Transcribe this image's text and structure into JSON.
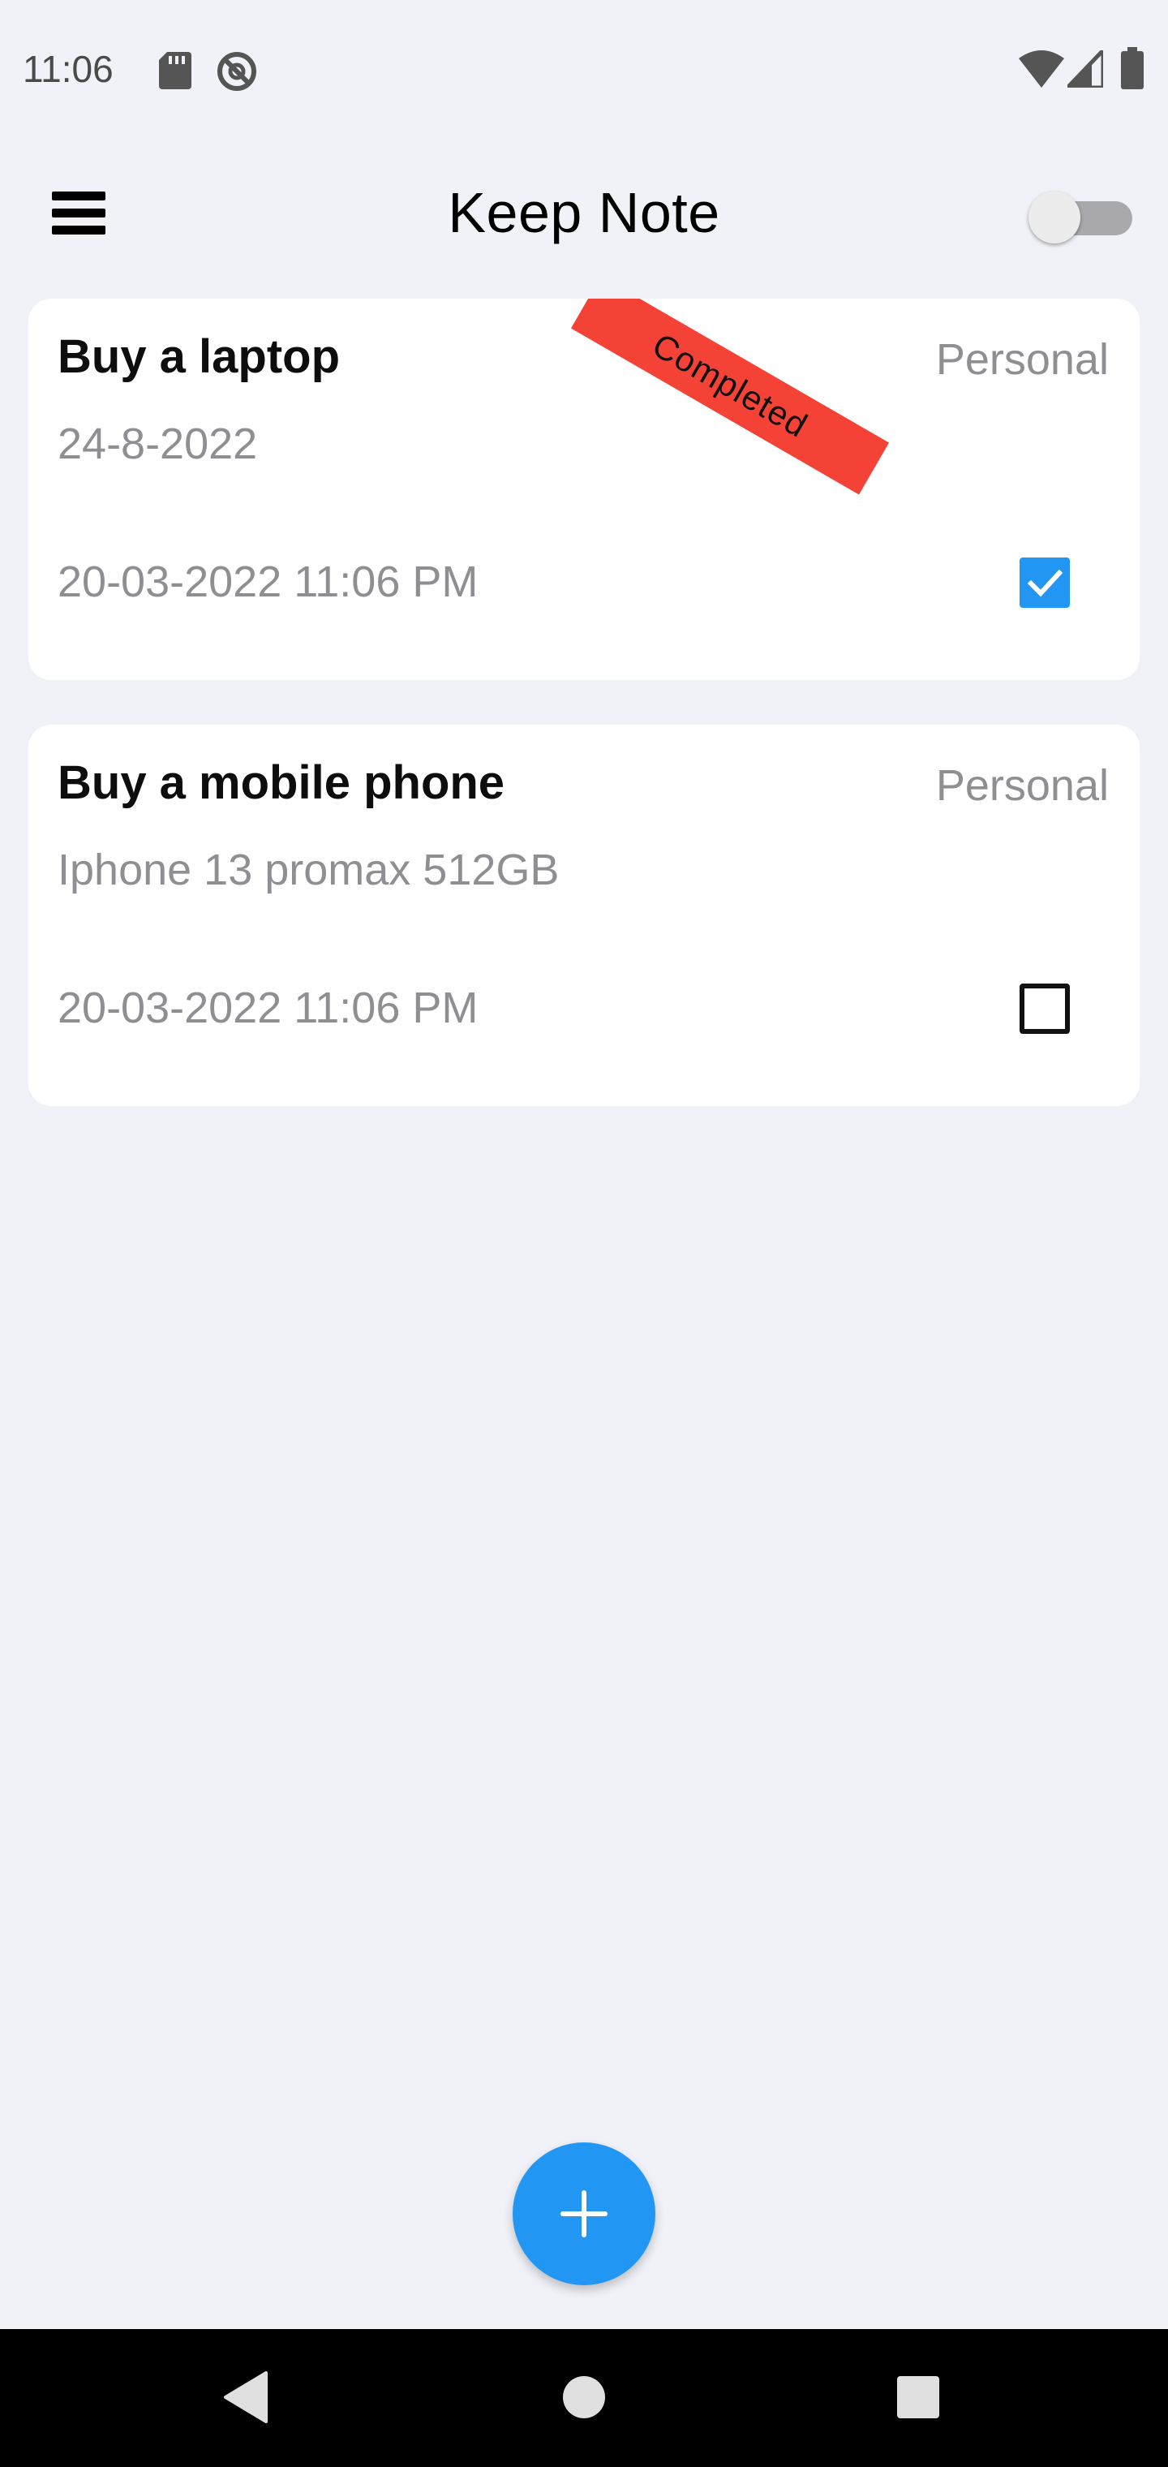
{
  "status_bar": {
    "time": "11:06",
    "icons": [
      "sd-card-icon",
      "do-not-disturb-icon",
      "wifi-icon",
      "cell-signal-icon",
      "battery-icon"
    ]
  },
  "app_bar": {
    "title": "Keep Note",
    "menu_icon": "hamburger-menu-icon",
    "theme_toggle_on": false
  },
  "notes": [
    {
      "title": "Buy a laptop",
      "category": "Personal",
      "description": "24-8-2022",
      "datetime": "20-03-2022 11:06 PM",
      "completed": true,
      "ribbon_label": "Completed"
    },
    {
      "title": "Buy a mobile phone",
      "category": "Personal",
      "description": "Iphone 13 promax 512GB",
      "datetime": "20-03-2022 11:06 PM",
      "completed": false
    }
  ],
  "fab": {
    "icon": "plus-icon"
  },
  "nav_bar": {
    "icons": [
      "back-icon",
      "home-icon",
      "recents-icon"
    ]
  },
  "colors": {
    "accent": "#2196f3",
    "ribbon": "#f44336",
    "background": "#f0f2f7",
    "secondary_text": "#8e8e93"
  }
}
